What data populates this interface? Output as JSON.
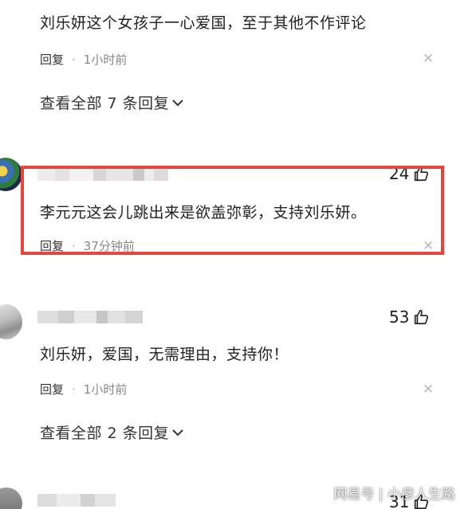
{
  "comments": [
    {
      "text": "刘乐妍这个女孩子一心爱国，至于其他不作评论",
      "reply_label": "回复",
      "time": "1小时前"
    },
    {
      "likes": "24",
      "text": "李元元这会儿跳出来是欲盖弥彰，支持刘乐妍。",
      "reply_label": "回复",
      "time": "37分钟前"
    },
    {
      "likes": "53",
      "text": "刘乐妍，爱国，无需理由，支持你！",
      "reply_label": "回复",
      "time": "1小时前"
    },
    {
      "likes": "31"
    }
  ],
  "view_all_1": "查看全部 7 条回复",
  "view_all_2": "查看全部 2 条回复",
  "watermark": "网易号 | 小彦人生路",
  "icons": {
    "close": "close-icon",
    "like": "thumbs-up-icon",
    "expand": "chevron-down-icon"
  },
  "colors": {
    "highlight_border": "#e8463c"
  }
}
